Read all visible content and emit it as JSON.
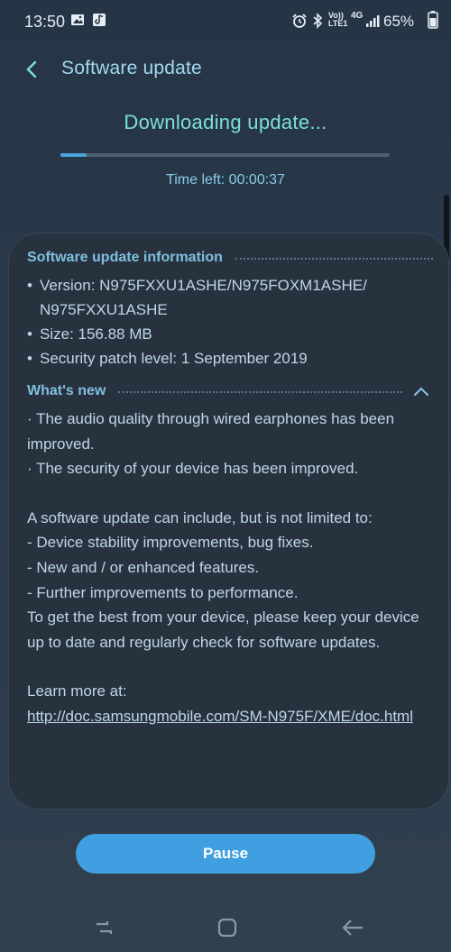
{
  "status_bar": {
    "time": "13:50",
    "battery_percent": "65%",
    "left_icons": [
      "image-icon",
      "app-notification-icon"
    ],
    "right_icons": [
      "alarm-icon",
      "bluetooth-icon",
      "volte-icon",
      "4g-icon",
      "signal-icon"
    ],
    "volte_label": "Vo)) LTE1",
    "net_label": "4G"
  },
  "header": {
    "title": "Software update",
    "back_icon": "back-chevron-icon"
  },
  "download": {
    "status": "Downloading update...",
    "progress": 0.08,
    "time_left": "Time left: 00:00:37"
  },
  "info": {
    "title": "Software update information",
    "items": [
      "Version: N975FXXU1ASHE/N975FOXM1ASHE/\nN975FXXU1ASHE",
      "Size: 156.88 MB",
      "Security patch level: 1 September 2019"
    ]
  },
  "whats_new": {
    "title": "What's new",
    "collapse_icon": "chevron-up-icon",
    "changes": "· The audio quality through wired earphones has been improved.\n· The security of your device has been improved.",
    "disclaimer": "A software update can include, but is not limited to:\n - Device stability improvements, bug fixes.\n - New and / or enhanced features.\n - Further improvements to performance.\nTo get the best from your device, please keep your device up to date and regularly check for software updates.",
    "learn_more": "Learn more at:",
    "link": "http://doc.samsungmobile.com/SM-N975F/XME/doc.html"
  },
  "actions": {
    "pause_label": "Pause"
  },
  "nav_bar": {
    "icons": [
      "recents-icon",
      "home-icon",
      "back-icon"
    ]
  },
  "colors": {
    "background": "#263444",
    "accent": "#7de0d3",
    "header_text": "#a3d8ec",
    "section_title": "#7fbfdf",
    "button": "#3f9fe0"
  }
}
